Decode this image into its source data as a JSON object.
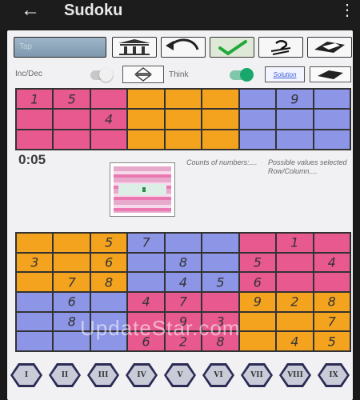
{
  "appbar": {
    "title": "Sudoku",
    "back_icon": "arrow-left-icon",
    "more_icon": "more-vertical-icon"
  },
  "toolbar": {
    "input_placeholder": "Tap",
    "buttons": [
      "bank-icon",
      "undo-icon",
      "check-icon",
      "hint-icon",
      "eraser-icon"
    ]
  },
  "options": {
    "incdec_label": "Inc/Dec",
    "incdec_on": false,
    "think_label": "Think",
    "think_on": true,
    "solution_label": "Solution"
  },
  "timer": "0:05",
  "notes": {
    "counts": "Counts of numbers:....",
    "possible": "Possible values selected Row/Column...."
  },
  "top_grid": {
    "colors": [
      "p",
      "p",
      "p",
      "o",
      "o",
      "o",
      "b",
      "b",
      "b"
    ],
    "rows": [
      [
        "1",
        "5",
        "",
        "",
        "",
        "",
        "",
        "9",
        ""
      ],
      [
        "",
        "",
        "4",
        "",
        "",
        "",
        "",
        "",
        ""
      ],
      [
        "",
        "",
        "",
        "",
        "",
        "",
        "",
        "",
        ""
      ]
    ]
  },
  "main_grid": {
    "colors": [
      [
        "o",
        "o",
        "o",
        "b",
        "b",
        "b",
        "p",
        "p",
        "p"
      ],
      [
        "o",
        "o",
        "o",
        "b",
        "b",
        "b",
        "p",
        "p",
        "p"
      ],
      [
        "o",
        "o",
        "o",
        "b",
        "b",
        "b",
        "p",
        "p",
        "p"
      ],
      [
        "b",
        "b",
        "b",
        "p",
        "p",
        "p",
        "o",
        "o",
        "o"
      ],
      [
        "b",
        "b",
        "b",
        "p",
        "p",
        "p",
        "o",
        "o",
        "o"
      ],
      [
        "b",
        "b",
        "b",
        "p",
        "p",
        "p",
        "o",
        "o",
        "o"
      ]
    ],
    "rows": [
      [
        "",
        "",
        "5",
        "7",
        "",
        "",
        "",
        "1",
        ""
      ],
      [
        "3",
        "",
        "6",
        "",
        "8",
        "",
        "5",
        "",
        "4"
      ],
      [
        "",
        "7",
        "8",
        "",
        "4",
        "5",
        "6",
        "",
        ""
      ],
      [
        "",
        "6",
        "",
        "4",
        "7",
        "",
        "9",
        "2",
        "8"
      ],
      [
        "",
        "8",
        "",
        "",
        "9",
        "3",
        "",
        "",
        "7"
      ],
      [
        "",
        "",
        "",
        "6",
        "2",
        "8",
        "",
        "4",
        "5"
      ]
    ]
  },
  "numbers": [
    "I",
    "II",
    "III",
    "IV",
    "V",
    "VI",
    "VII",
    "VIII",
    "IX"
  ],
  "watermark": "UpdateStar.com",
  "colors": {
    "pink": "#e8598f",
    "orange": "#f4a31f",
    "blue": "#8c95e6",
    "toggle_on": "#1aa76e"
  }
}
